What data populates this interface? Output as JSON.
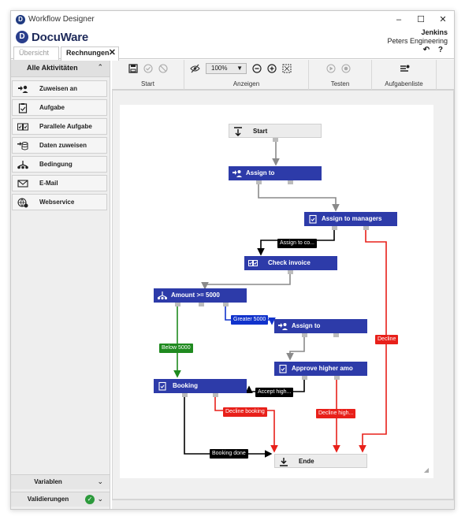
{
  "window": {
    "title": "Workflow Designer",
    "controls": [
      "–",
      "☐",
      "✕"
    ]
  },
  "brand": {
    "logo_letter": "D",
    "name": "DocuWare"
  },
  "user": {
    "name": "Jenkins",
    "org": "Peters Engineering",
    "icons": "↶ ?"
  },
  "tabs": [
    {
      "label": "Übersicht",
      "active": false
    },
    {
      "label": "Rechnungen",
      "active": true,
      "close": "✕"
    }
  ],
  "sidebar": {
    "header": "Alle Aktivitäten",
    "header_chevron": "⌃",
    "items": [
      {
        "label": "Zuweisen an",
        "icon": "assign-user-icon"
      },
      {
        "label": "Aufgabe",
        "icon": "task-icon"
      },
      {
        "label": "Parallele Aufgabe",
        "icon": "parallel-task-icon"
      },
      {
        "label": "Daten zuweisen",
        "icon": "assign-data-icon"
      },
      {
        "label": "Bedingung",
        "icon": "condition-icon"
      },
      {
        "label": "E-Mail",
        "icon": "email-icon"
      },
      {
        "label": "Webservice",
        "icon": "webservice-icon"
      }
    ],
    "footer": [
      {
        "label": "Variablen",
        "chevron": "⌄"
      },
      {
        "label": "Validierungen",
        "chevron": "⌄",
        "status": "ok"
      }
    ]
  },
  "toolbar": {
    "groups": [
      {
        "label": "Start"
      },
      {
        "label": "Anzeigen",
        "zoom": "100%"
      },
      {
        "label": "Testen"
      },
      {
        "label": "Aufgabenliste"
      }
    ]
  },
  "workflow": {
    "nodes": {
      "start": "Start",
      "assign1": "Assign to",
      "assign_managers": "Assign to managers",
      "check_invoice": "Check invoice",
      "amount": "Amount >= 5000",
      "assign2": "Assign to",
      "approve_higher": "Approve higher amo",
      "booking": "Booking",
      "end": "Ende"
    },
    "edge_labels": {
      "assign_to_co": "Assign to co...",
      "greater_5000": "Greater 5000",
      "below_5000": "Below 5000",
      "decline": "Decline",
      "accept_high": "Accept high...",
      "decline_booking": "Decline booking",
      "decline_high": "Decline high...",
      "booking_done": "Booking done"
    }
  },
  "colors": {
    "node_blue": "#2d3ba9",
    "edge_gray": "#8a8a8a",
    "edge_red": "#e8201a",
    "edge_green": "#1f8a1f",
    "edge_blue": "#1133cc",
    "edge_black": "#000000"
  }
}
